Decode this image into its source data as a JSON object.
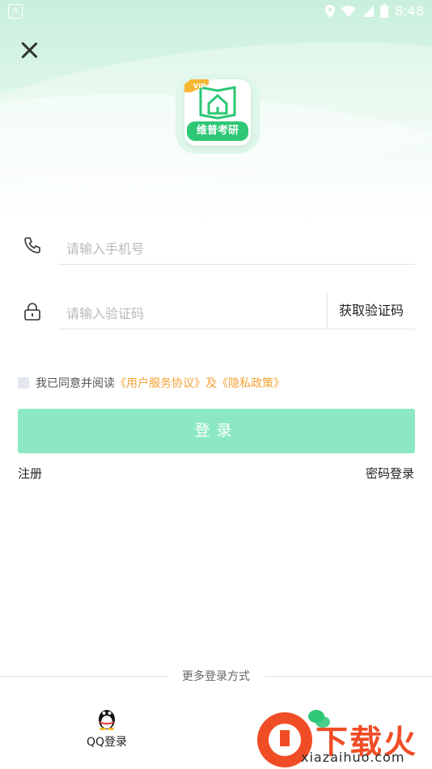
{
  "status_bar": {
    "time": "8:48"
  },
  "logo": {
    "badge": "VIP",
    "name": "维普考研"
  },
  "phone_field": {
    "placeholder": "请输入手机号"
  },
  "code_field": {
    "placeholder": "请输入验证码"
  },
  "get_code_label": "获取验证码",
  "agreement": {
    "prefix": "我已同意并阅读",
    "user_agreement": "《用户服务协议》",
    "and": "及",
    "privacy_policy": "《隐私政策》"
  },
  "login_button": "登录",
  "register_link": "注册",
  "password_login_link": "密码登录",
  "more_methods": "更多登录方式",
  "qq_login": "QQ登录",
  "colors": {
    "accent_green": "#2dc776",
    "button_disabled": "#8ce8c3",
    "link_orange": "#f3a233"
  }
}
